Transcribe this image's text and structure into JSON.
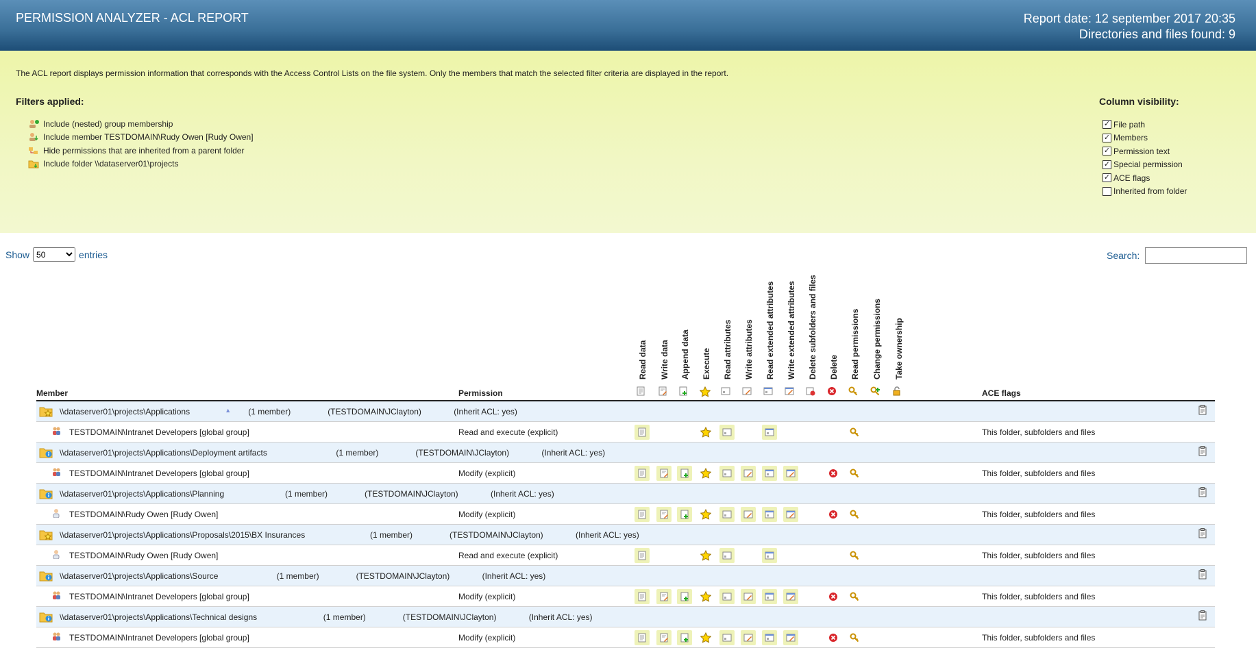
{
  "header": {
    "title": "PERMISSION ANALYZER - ACL REPORT",
    "report_date": "Report date: 12 september 2017 20:35",
    "found": "Directories and files found: 9"
  },
  "intro": {
    "description": "The ACL report displays permission information that corresponds with the Access Control Lists on the file system. Only the members that match the selected filter criteria are displayed in the report.",
    "filters_title": "Filters applied:",
    "filters": [
      {
        "icon": "group-membership-icon",
        "label": "Include (nested) group membership"
      },
      {
        "icon": "include-member-icon",
        "label": "Include member TESTDOMAIN\\Rudy Owen [Rudy Owen]"
      },
      {
        "icon": "hide-inherited-icon",
        "label": "Hide permissions that are inherited from a parent folder"
      },
      {
        "icon": "include-folder-icon",
        "label": "Include folder \\\\dataserver01\\projects"
      }
    ],
    "colvis_title": "Column visibility:",
    "columns": [
      {
        "label": "File path",
        "checked": true
      },
      {
        "label": "Members",
        "checked": true
      },
      {
        "label": "Permission text",
        "checked": true
      },
      {
        "label": "Special permission",
        "checked": true
      },
      {
        "label": "ACE flags",
        "checked": true
      },
      {
        "label": "Inherited from folder",
        "checked": false
      }
    ]
  },
  "controls": {
    "show_label": "Show",
    "entries_label": "entries",
    "page_size": "50",
    "page_size_options": [
      "10",
      "25",
      "50",
      "100"
    ],
    "search_label": "Search:",
    "search_value": ""
  },
  "table": {
    "member_header": "Member",
    "permission_header": "Permission",
    "ace_header": "ACE flags",
    "perm_columns": [
      "Read data",
      "Write data",
      "Append data",
      "Execute",
      "Read attributes",
      "Write attributes",
      "Read extended attributes",
      "Write extended attributes",
      "Delete subfolders and files",
      "Delete",
      "Read permissions",
      "Change permissions",
      "Take ownership"
    ],
    "rows": [
      {
        "type": "folder",
        "icon": "folder-star-icon",
        "path": "\\\\dataserver01\\projects\\Applications",
        "members": "(1 member)",
        "owner": "(TESTDOMAIN\\JClayton)",
        "inherit": "(Inherit ACL: yes)",
        "sorted": true
      },
      {
        "type": "member",
        "icon": "group-icon",
        "name": "TESTDOMAIN\\Intranet Developers [global group]",
        "permission": "Read and execute (explicit)",
        "perms": [
          1,
          0,
          0,
          1,
          1,
          0,
          1,
          0,
          0,
          0,
          1,
          0,
          0
        ],
        "ace": "This folder, subfolders and files"
      },
      {
        "type": "folder",
        "icon": "folder-info-icon",
        "path": "\\\\dataserver01\\projects\\Applications\\Deployment artifacts",
        "members": "(1 member)",
        "owner": "(TESTDOMAIN\\JClayton)",
        "inherit": "(Inherit ACL: yes)"
      },
      {
        "type": "member",
        "icon": "group-icon",
        "name": "TESTDOMAIN\\Intranet Developers [global group]",
        "permission": "Modify (explicit)",
        "perms": [
          1,
          1,
          1,
          1,
          1,
          1,
          1,
          1,
          0,
          1,
          1,
          0,
          0
        ],
        "ace": "This folder, subfolders and files"
      },
      {
        "type": "folder",
        "icon": "folder-info-icon",
        "path": "\\\\dataserver01\\projects\\Applications\\Planning",
        "members": "(1 member)",
        "owner": "(TESTDOMAIN\\JClayton)",
        "inherit": "(Inherit ACL: yes)"
      },
      {
        "type": "member",
        "icon": "user-icon",
        "name": "TESTDOMAIN\\Rudy Owen [Rudy Owen]",
        "permission": "Modify (explicit)",
        "perms": [
          1,
          1,
          1,
          1,
          1,
          1,
          1,
          1,
          0,
          1,
          1,
          0,
          0
        ],
        "ace": "This folder, subfolders and files"
      },
      {
        "type": "folder",
        "icon": "folder-star-icon",
        "path": "\\\\dataserver01\\projects\\Applications\\Proposals\\2015\\BX Insurances",
        "members": "(1 member)",
        "owner": "(TESTDOMAIN\\JClayton)",
        "inherit": "(Inherit ACL: yes)"
      },
      {
        "type": "member",
        "icon": "user-icon",
        "name": "TESTDOMAIN\\Rudy Owen [Rudy Owen]",
        "permission": "Read and execute (explicit)",
        "perms": [
          1,
          0,
          0,
          1,
          1,
          0,
          1,
          0,
          0,
          0,
          1,
          0,
          0
        ],
        "ace": "This folder, subfolders and files"
      },
      {
        "type": "folder",
        "icon": "folder-info-icon",
        "path": "\\\\dataserver01\\projects\\Applications\\Source",
        "members": "(1 member)",
        "owner": "(TESTDOMAIN\\JClayton)",
        "inherit": "(Inherit ACL: yes)"
      },
      {
        "type": "member",
        "icon": "group-icon",
        "name": "TESTDOMAIN\\Intranet Developers [global group]",
        "permission": "Modify (explicit)",
        "perms": [
          1,
          1,
          1,
          1,
          1,
          1,
          1,
          1,
          0,
          1,
          1,
          0,
          0
        ],
        "ace": "This folder, subfolders and files"
      },
      {
        "type": "folder",
        "icon": "folder-info-icon",
        "path": "\\\\dataserver01\\projects\\Applications\\Technical designs",
        "members": "(1 member)",
        "owner": "(TESTDOMAIN\\JClayton)",
        "inherit": "(Inherit ACL: yes)"
      },
      {
        "type": "member",
        "icon": "group-icon",
        "name": "TESTDOMAIN\\Intranet Developers [global group]",
        "permission": "Modify (explicit)",
        "perms": [
          1,
          1,
          1,
          1,
          1,
          1,
          1,
          1,
          0,
          1,
          1,
          0,
          0
        ],
        "ace": "This folder, subfolders and files"
      }
    ]
  }
}
